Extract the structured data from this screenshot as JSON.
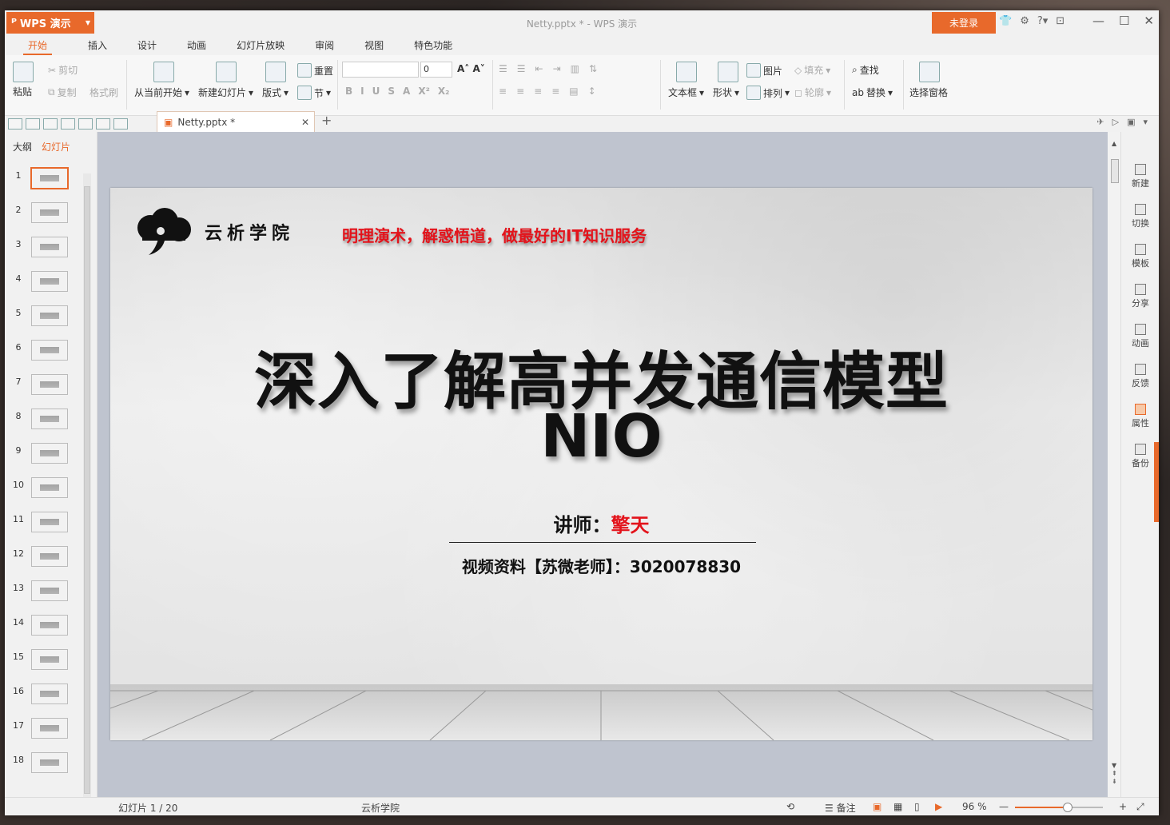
{
  "app": {
    "name": "WPS 演示",
    "doc_title": "Netty.pptx * - WPS 演示",
    "login_label": "未登录"
  },
  "menu": {
    "tabs": [
      "开始",
      "插入",
      "设计",
      "动画",
      "幻灯片放映",
      "审阅",
      "视图",
      "特色功能"
    ]
  },
  "ribbon": {
    "paste": "粘贴",
    "cut": "剪切",
    "copy": "复制",
    "format_painter": "格式刷",
    "from_current": "从当前开始",
    "new_slide": "新建幻灯片",
    "layout": "版式",
    "reset": "重置",
    "section": "节",
    "font_size": "0",
    "text_box": "文本框",
    "shape": "形状",
    "picture": "图片",
    "arrange": "排列",
    "fill": "填充",
    "outline": "轮廓",
    "find": "查找",
    "replace": "替换",
    "selection_pane": "选择窗格"
  },
  "doc_tab": {
    "label": "Netty.pptx *"
  },
  "left_panel": {
    "tab_outline": "大纲",
    "tab_slides": "幻灯片",
    "slide_numbers": [
      "1",
      "2",
      "3",
      "4",
      "5",
      "6",
      "7",
      "8",
      "9",
      "10",
      "11",
      "12",
      "13",
      "14",
      "15",
      "16",
      "17",
      "18"
    ]
  },
  "slide": {
    "brand": "云析学院",
    "slogan": "明理演术，解惑悟道，做最好的IT知识服务",
    "title_line1": "深入了解高并发通信模型",
    "title_line2": "NIO",
    "lecturer_label": "讲师：",
    "lecturer_name": "擎天",
    "contact": "视频资料【苏微老师】：3020078830"
  },
  "right_panel": {
    "items": [
      "新建",
      "切换",
      "模板",
      "分享",
      "动画",
      "反馈",
      "属性",
      "备份"
    ]
  },
  "status": {
    "slide_pos": "幻灯片 1 / 20",
    "theme": "云析学院",
    "notes": "备注",
    "zoom": "96 %",
    "zoom_fraction": 0.6
  },
  "colors": {
    "accent": "#e8692b",
    "slogan_red": "#e3131b"
  }
}
